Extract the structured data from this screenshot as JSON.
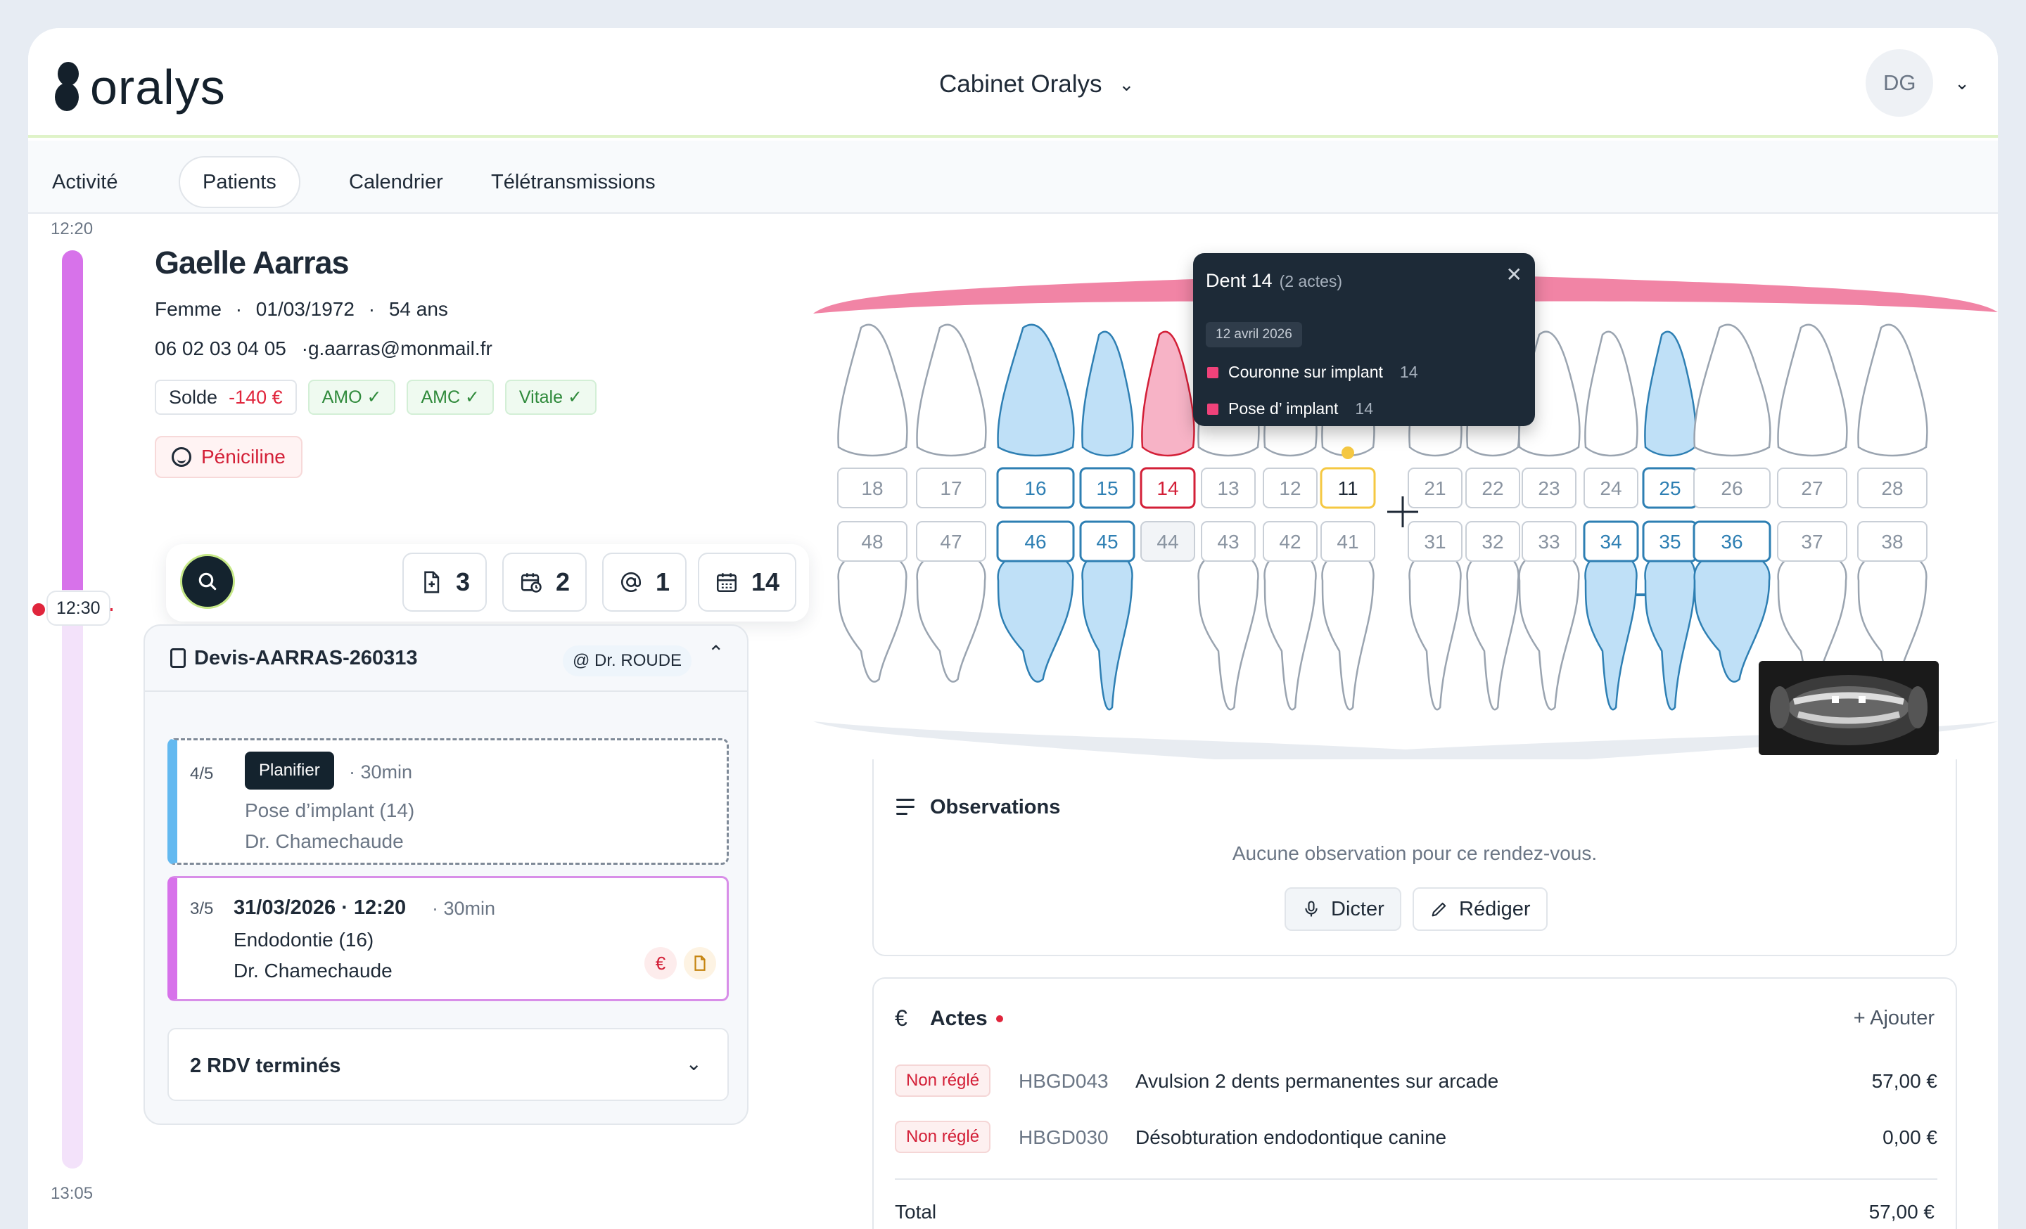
{
  "brand": {
    "name": "oralys"
  },
  "header": {
    "cabinet": "Cabinet Oralys",
    "user_initials": "DG"
  },
  "nav": {
    "tabs": [
      "Activité",
      "Patients",
      "Calendrier",
      "Télétransmissions"
    ],
    "active": "Patients"
  },
  "timeline": {
    "start": "12:20",
    "now": "12:30",
    "end": "13:05",
    "progress": 0.37
  },
  "patient": {
    "name": "Gaelle Aarras",
    "sex": "Femme",
    "birth": "01/03/1972",
    "age": "54 ans",
    "phone": "06 02 03 04 05",
    "email": "·g.aarras@monmail.fr",
    "solde_label": "Solde",
    "solde_value": "-140 €",
    "coverage": [
      "AMO ✓",
      "AMC ✓",
      "Vitale ✓"
    ],
    "allergy": "Péniciline"
  },
  "toolbar": {
    "counters": [
      "3",
      "2",
      "1",
      "14"
    ]
  },
  "devis": {
    "title": "Devis-AARRAS-260313",
    "doctor_badge": "@ Dr. ROUDE",
    "step1": {
      "fraction": "4/5",
      "button": "Planifier",
      "duration": "· 30min",
      "act": "Pose d’implant (14)",
      "doctor": "Dr. Chamechaude"
    },
    "step2": {
      "fraction": "3/5",
      "datetime": "31/03/2026 · 12:20",
      "duration": "· 30min",
      "act": "Endodontie (16)",
      "doctor": "Dr. Chamechaude"
    },
    "done": "2 RDV terminés"
  },
  "dental_chart": {
    "upper": [
      "18",
      "17",
      "16",
      "15",
      "14",
      "13",
      "12",
      "11",
      "21",
      "22",
      "23",
      "24",
      "25",
      "26",
      "27",
      "28"
    ],
    "lower": [
      "48",
      "47",
      "46",
      "45",
      "44",
      "43",
      "42",
      "41",
      "31",
      "32",
      "33",
      "34",
      "35",
      "36",
      "37",
      "38"
    ],
    "highlighted_blue": [
      "16",
      "15",
      "25",
      "46",
      "45",
      "34",
      "35",
      "36"
    ],
    "highlighted_red": [
      "14"
    ],
    "highlighted_yellow": [
      "11"
    ],
    "missing": [
      "44"
    ],
    "colors": {
      "blue": "#2e7fb3",
      "red": "#d31f37",
      "yellow": "#f5c842",
      "gum": "#ef6f95"
    }
  },
  "tooltip": {
    "title": "Dent 14",
    "subtitle": "(2 actes)",
    "date": "12 avril 2026",
    "acts": [
      {
        "label": "Couronne sur implant",
        "tooth": "14"
      },
      {
        "label": "Pose d’ implant",
        "tooth": "14"
      }
    ]
  },
  "observations": {
    "title": "Observations",
    "empty": "Aucune observation pour ce rendez-vous.",
    "dicter": "Dicter",
    "rediger": "Rédiger"
  },
  "actes": {
    "currency_symbol": "€",
    "title": "Actes",
    "add": "+ Ajouter",
    "rows": [
      {
        "status": "Non réglé",
        "code": "HBGD043",
        "label": "Avulsion 2 dents permanentes sur arcade",
        "price": "57,00 €"
      },
      {
        "status": "Non réglé",
        "code": "HBGD030",
        "label": "Désobturation endodontique canine",
        "price": "0,00 €"
      }
    ],
    "total_label": "Total",
    "total_value": "57,00 €"
  }
}
